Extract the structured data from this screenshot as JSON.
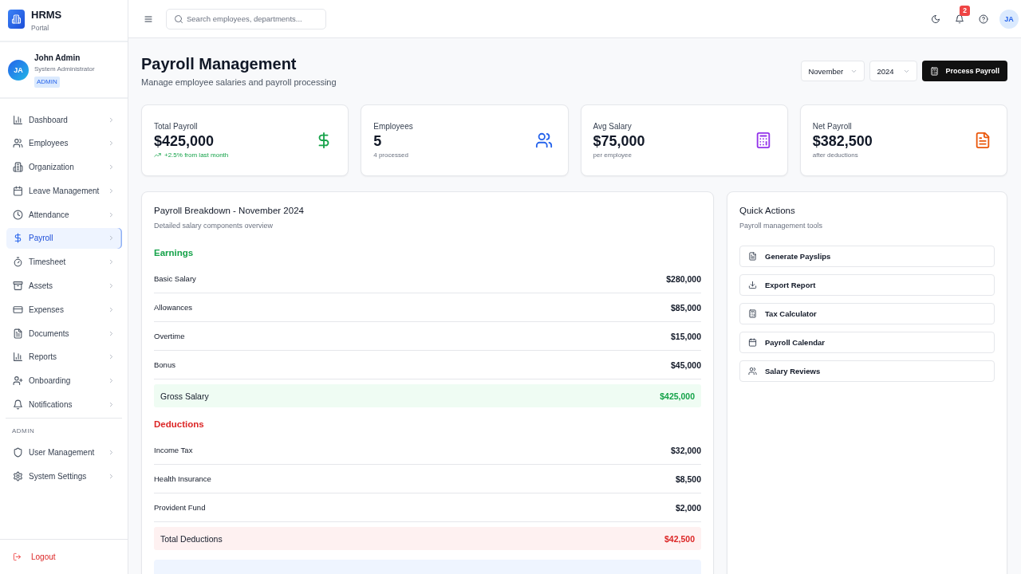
{
  "sidebar": {
    "brand": {
      "name": "HRMS",
      "tagline": "Portal"
    },
    "user": {
      "initials": "JA",
      "name": "John Admin",
      "role": "System Administrator",
      "badge": "ADMIN"
    },
    "nav_items": [
      {
        "label": "Dashboard",
        "selected": false
      },
      {
        "label": "Employees",
        "selected": false
      },
      {
        "label": "Organization",
        "selected": false
      },
      {
        "label": "Leave Management",
        "selected": false
      },
      {
        "label": "Attendance",
        "selected": false
      },
      {
        "label": "Payroll",
        "selected": true
      },
      {
        "label": "Timesheet",
        "selected": false
      },
      {
        "label": "Assets",
        "selected": false
      },
      {
        "label": "Expenses",
        "selected": false
      },
      {
        "label": "Documents",
        "selected": false
      },
      {
        "label": "Reports",
        "selected": false
      },
      {
        "label": "Onboarding",
        "selected": false
      },
      {
        "label": "Notifications",
        "selected": false
      }
    ],
    "admin_section": {
      "heading": "ADMIN",
      "items": [
        {
          "label": "User Management",
          "selected": false
        },
        {
          "label": "System Settings",
          "selected": false
        }
      ]
    },
    "logout": "Logout"
  },
  "top_bar": {
    "search": {
      "placeholder": "Search employees, departments..."
    },
    "notification_count": "2",
    "avatar_initials": "JA"
  },
  "header": {
    "title": "Payroll Management",
    "subtitle": "Manage employee salaries and payroll processing",
    "month": "November",
    "year": "2024",
    "action": "Process Payroll"
  },
  "stats": [
    {
      "label": "Total Payroll",
      "value": "$425,000",
      "note": "+2.5% from last month",
      "trend": true,
      "color": "#16a34a"
    },
    {
      "label": "Employees",
      "value": "5",
      "note": "4 processed",
      "trend": false,
      "color": "#2563eb"
    },
    {
      "label": "Avg Salary",
      "value": "$75,000",
      "note": "per employee",
      "trend": false,
      "color": "#9333ea"
    },
    {
      "label": "Net Payroll",
      "value": "$382,500",
      "note": "after deductions",
      "trend": false,
      "color": "#ea580c"
    }
  ],
  "breakdown": {
    "title": "Payroll Breakdown - November 2024",
    "subtitle": "Detailed salary components overview",
    "sections": [
      {
        "heading": "Earnings",
        "kind": "earnings",
        "rows": [
          {
            "label": "Basic Salary",
            "amount": "$280,000"
          },
          {
            "label": "Allowances",
            "amount": "$85,000"
          },
          {
            "label": "Overtime",
            "amount": "$15,000"
          },
          {
            "label": "Bonus",
            "amount": "$45,000"
          }
        ],
        "total": {
          "label": "Gross Salary",
          "amount": "$425,000"
        }
      },
      {
        "heading": "Deductions",
        "kind": "deductions",
        "rows": [
          {
            "label": "Income Tax",
            "amount": "$32,000"
          },
          {
            "label": "Health Insurance",
            "amount": "$8,500"
          },
          {
            "label": "Provident Fund",
            "amount": "$2,000"
          }
        ],
        "total": {
          "label": "Total Deductions",
          "amount": "$42,500"
        }
      }
    ]
  },
  "quick_actions": {
    "title": "Quick Actions",
    "subtitle": "Payroll management tools",
    "actions": [
      "Generate Payslips",
      "Export Report",
      "Tax Calculator",
      "Payroll Calendar",
      "Salary Reviews"
    ]
  }
}
